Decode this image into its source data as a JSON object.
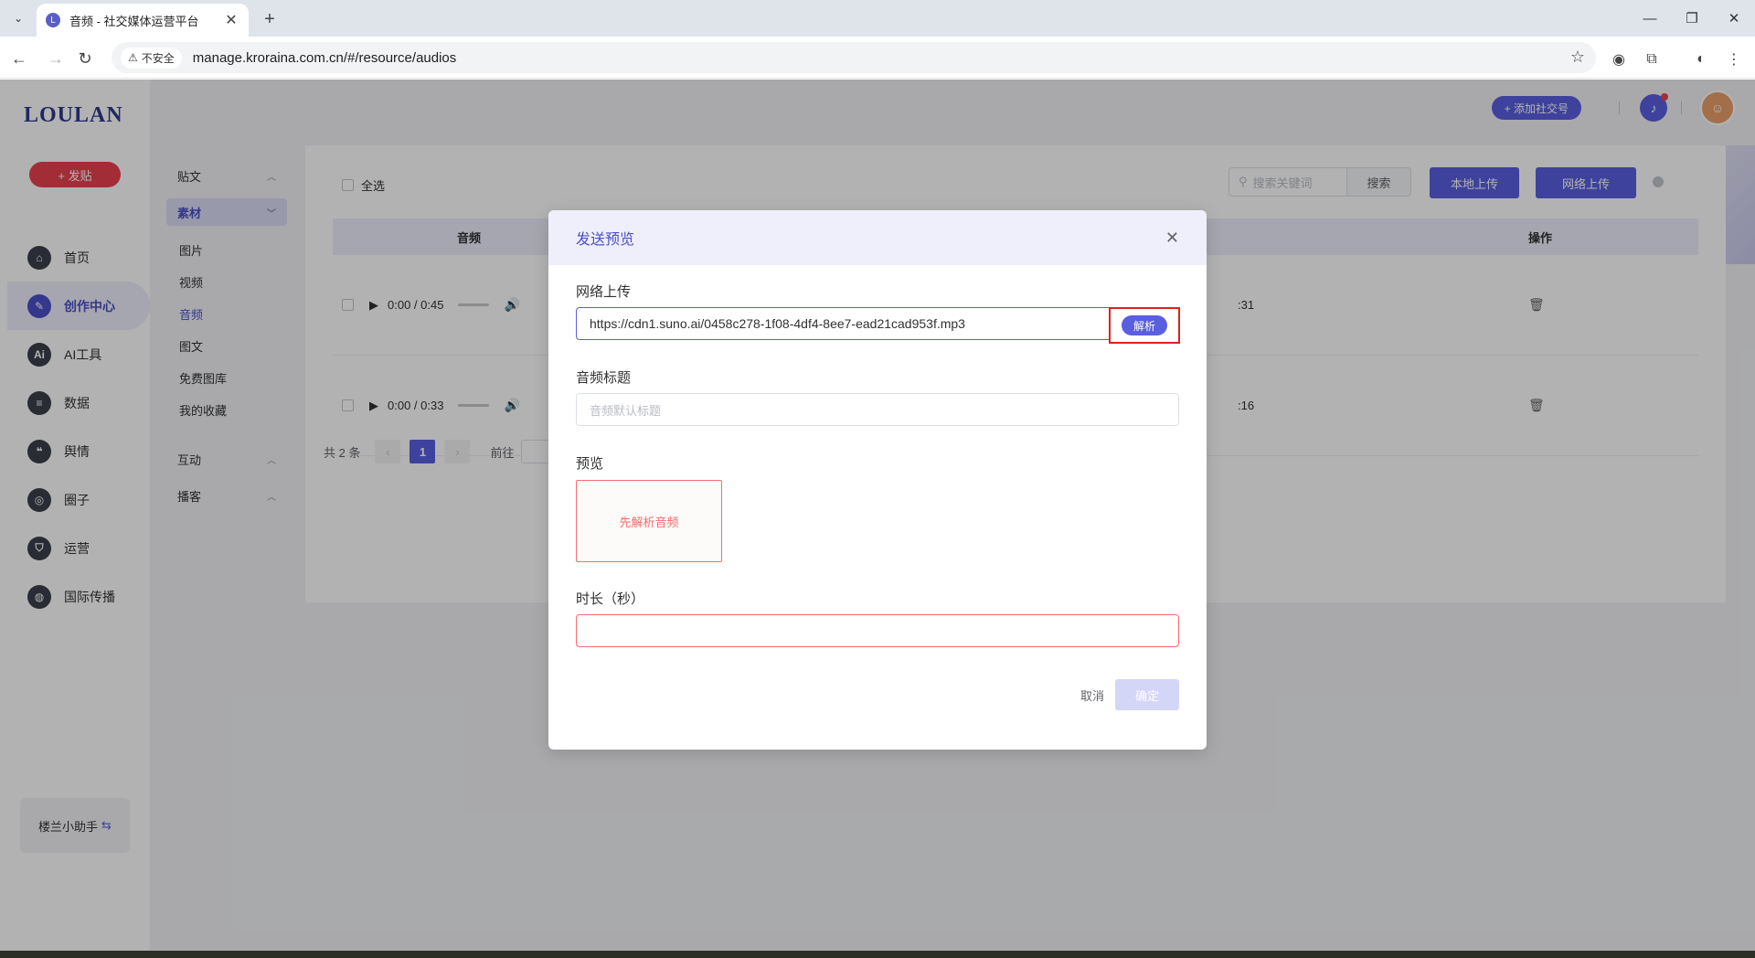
{
  "browser": {
    "tab_title": "音频 - 社交媒体运营平台",
    "insecure_label": "不安全",
    "url": "manage.kroraina.com.cn/#/resource/audios"
  },
  "app": {
    "logo": "LOULAN",
    "publish_label": "+ 发贴",
    "add_social_label": "+ 添加社交号",
    "avatar_icon": "avatar-icon",
    "nav": [
      {
        "label": "首页",
        "icon": "home-icon",
        "glyph": "⌂"
      },
      {
        "label": "创作中心",
        "icon": "palette-icon",
        "glyph": "✎"
      },
      {
        "label": "AI工具",
        "icon": "ai-icon",
        "glyph": "Ai"
      },
      {
        "label": "数据",
        "icon": "database-icon",
        "glyph": "≡"
      },
      {
        "label": "舆情",
        "icon": "quote-icon",
        "glyph": "❝"
      },
      {
        "label": "圈子",
        "icon": "compass-icon",
        "glyph": "◎"
      },
      {
        "label": "运营",
        "icon": "shield-icon",
        "glyph": "⛉"
      },
      {
        "label": "国际传播",
        "icon": "globe-icon",
        "glyph": "◍"
      }
    ],
    "helper_label": "楼兰小助手"
  },
  "subnav": {
    "group_posts": "贴文",
    "group_materials": "素材",
    "items": [
      "图片",
      "视频",
      "音频",
      "图文",
      "免费图库",
      "我的收藏"
    ],
    "group_interact": "互动",
    "group_broadcast": "播客"
  },
  "content": {
    "select_all": "全选",
    "search_placeholder": "搜索关键词",
    "search_btn": "搜索",
    "local_upload": "本地上传",
    "network_upload": "网络上传",
    "col_audio": "音频",
    "col_action": "操作",
    "rows": [
      {
        "time": "0:00 / 0:45",
        "date_tail": ":31"
      },
      {
        "time": "0:00 / 0:33",
        "date_tail": ":16"
      }
    ],
    "pagination": {
      "total": "共 2 条",
      "page": "1",
      "goto": "前往"
    }
  },
  "modal": {
    "title": "发送预览",
    "network_upload_label": "网络上传",
    "url_value": "https://cdn1.suno.ai/0458c278-1f08-4df4-8ee7-ead21cad953f.mp3",
    "parse_btn": "解析",
    "audio_title_label": "音频标题",
    "audio_title_placeholder": "音频默认标题",
    "preview_label": "预览",
    "preview_hint": "先解析音频",
    "duration_label": "时长（秒）",
    "cancel": "取消",
    "confirm": "确定"
  },
  "colors": {
    "accent": "#5a5fe0",
    "danger": "#e8414e",
    "highlight_box": "#e02020"
  }
}
